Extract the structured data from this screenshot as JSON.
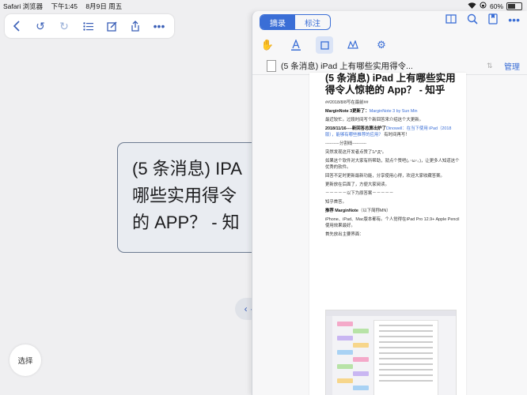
{
  "status": {
    "app": "Safari 浏览器",
    "time": "下午1:45",
    "date": "8月9日 周五",
    "battery": "60%",
    "battery_level": 0.6
  },
  "toolbar": {
    "buttons": [
      "back",
      "undo",
      "redo",
      "list",
      "edit",
      "share",
      "more"
    ]
  },
  "mindnode": {
    "lines": [
      "(5 条消息) IPA",
      "哪些实用得令",
      "的 APP？ - 知"
    ]
  },
  "select_button": "选择",
  "panel": {
    "tabs": [
      "摘录",
      "标注"
    ],
    "active_tab": "摘录",
    "doc_title": "(5 条消息) iPad 上有哪些实用得令...",
    "manage": "管理"
  },
  "page": {
    "heading": "(5 条消息) iPad 上有哪些实用得令人惊艳的 App？ - 知乎",
    "lines": [
      {
        "b": "",
        "t": "##2018/8/8写在最前##"
      },
      {
        "b": "MarginNote 3更新了：",
        "t": "",
        "link": "MarginNote 3 by Sun Min"
      },
      {
        "b": "",
        "t": "最近较忙。过段时间写个新回答来介绍这个大更新。"
      },
      {
        "b": "2018/11/16----新回答总算出炉了",
        "t": " 有时间再写！",
        "link": "Dinowell：在当下使用 iPad（2018版），能够有哪些推荐的应用？"
      },
      {
        "b": "",
        "t": "----------分割线----------"
      },
      {
        "b": "",
        "t": "突然发现这开发者点赞了1/°Д°。"
      },
      {
        "b": "",
        "t": "如果这个软件对大家有所帮助，就点个赞吧(｡･ω･｡)，让更多人知道这个优秀的软件。"
      },
      {
        "b": "",
        "t": "回答不定时更新最新功能，分享使用心得，欢迎大家收藏答案。"
      },
      {
        "b": "",
        "t": "更新放在后面了，方便大家阅读。"
      },
      {
        "b": "",
        "t": "－－－－－以下为原答案－－－－－"
      },
      {
        "b": "",
        "t": "知乎首答。"
      },
      {
        "b": "推荐 MarginNote",
        "t": "（以下简称MN）"
      },
      {
        "b": "",
        "t": "iPhone、iPad、Mac版本都有。个人觉得在iPad Pro 12.9+ Apple Pencil使用效果最好。"
      },
      {
        "b": "",
        "t": "首先放出主要界面："
      }
    ]
  },
  "colors": {
    "accent": "#3a6ed6",
    "note_colors": [
      "#f4a9c9",
      "#b8e3a7",
      "#c9b6f2",
      "#f7d68b",
      "#a9d2f4"
    ]
  }
}
